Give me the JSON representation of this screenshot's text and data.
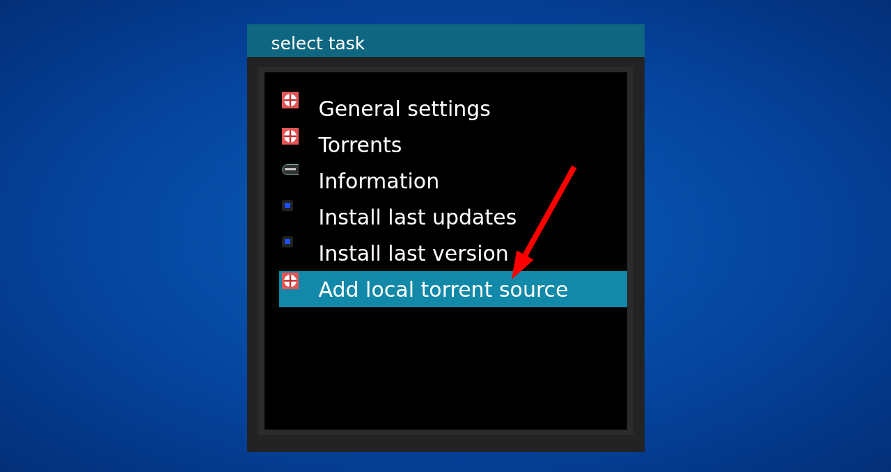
{
  "dialog": {
    "title": "select task",
    "items": [
      {
        "label": "General settings",
        "kind": "torrent",
        "selected": false
      },
      {
        "label": "Torrents",
        "kind": "torrent",
        "selected": false
      },
      {
        "label": "Information",
        "kind": "info",
        "selected": false
      },
      {
        "label": "Install last updates",
        "kind": "install",
        "selected": false
      },
      {
        "label": "Install last version",
        "kind": "install",
        "selected": false
      },
      {
        "label": "Add local torrent source",
        "kind": "torrent",
        "selected": true
      }
    ]
  }
}
